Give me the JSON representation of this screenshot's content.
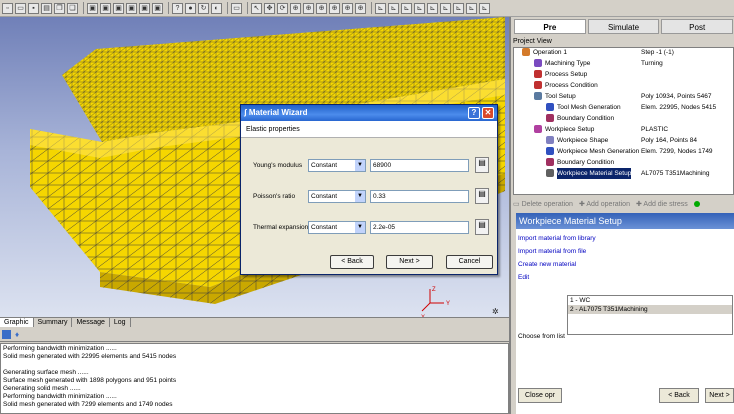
{
  "toolbar": {
    "icons": [
      "new-file-icon",
      "open-file-icon",
      "save-icon",
      "print-icon",
      "copy-icon",
      "paste-icon",
      "cube-icon",
      "cube-icon",
      "cube-icon",
      "cube-icon",
      "cube-icon",
      "cube-icon",
      "help-pointer-icon",
      "stop-icon",
      "refresh-icon",
      "color-icon",
      "rectangle-icon",
      "pointer-icon",
      "pan-icon",
      "rotate-icon",
      "zoom-icon",
      "zoom-icon",
      "zoom-icon",
      "zoom-icon",
      "zoom-icon",
      "zoom-icon",
      "axis-icon",
      "axis-icon",
      "axis-icon",
      "axis-icon",
      "axis-icon",
      "axis-icon",
      "axis-icon",
      "axis-icon",
      "axis-icon"
    ]
  },
  "viewport": {
    "tabs": [
      "Graphic",
      "Summary",
      "Message",
      "Log"
    ],
    "active_tab": "Graphic",
    "axis_labels": {
      "x": "X",
      "y": "Y",
      "z": "Z"
    },
    "mesh_color": "#f5d600"
  },
  "log": {
    "lines": [
      "Performing bandwidth minimization ......",
      "Solid mesh generated with 22995 elements and 5415 nodes",
      "",
      "Generating surface mesh ......",
      "Surface mesh generated with 1898 polygons and 951 points",
      "Generating solid mesh ......",
      "Performing bandwidth minimization ......",
      "Solid mesh generated with 7299 elements and 1749 nodes"
    ]
  },
  "right_panel": {
    "tabs": [
      "Pre",
      "Simulate",
      "Post"
    ],
    "active_tab": "Pre",
    "project_view_label": "Project View",
    "tree": [
      {
        "label": "Operation 1",
        "value": "Step -1 (-1)",
        "indent": 0,
        "icon": "operation-icon"
      },
      {
        "label": "Machining Type",
        "value": "Turning",
        "indent": 1,
        "icon": "machining-type-icon"
      },
      {
        "label": "Process Setup",
        "value": "",
        "indent": 1,
        "icon": "process-setup-icon"
      },
      {
        "label": "Process Condition",
        "value": "",
        "indent": 1,
        "icon": "process-condition-icon"
      },
      {
        "label": "Tool Setup",
        "value": "Poly 10934, Points 5467",
        "indent": 1,
        "icon": "tool-setup-icon"
      },
      {
        "label": "Tool Mesh Generation",
        "value": "Elem. 22995, Nodes 5415",
        "indent": 2,
        "icon": "mesh-icon"
      },
      {
        "label": "Boundary Condition",
        "value": "",
        "indent": 2,
        "icon": "boundary-icon"
      },
      {
        "label": "Workpiece Setup",
        "value": "PLASTIC",
        "indent": 1,
        "icon": "workpiece-setup-icon"
      },
      {
        "label": "Workpiece Shape",
        "value": "Poly 164, Points 84",
        "indent": 2,
        "icon": "shape-icon"
      },
      {
        "label": "Workpiece Mesh Generation",
        "value": "Elem. 7299, Nodes 1749",
        "indent": 2,
        "icon": "mesh-icon"
      },
      {
        "label": "Boundary Condition",
        "value": "",
        "indent": 2,
        "icon": "boundary-icon"
      },
      {
        "label": "Workpiece Material Setup",
        "value": "AL7075 T351Machining",
        "indent": 2,
        "icon": "material-icon",
        "selected": true
      }
    ],
    "operations": {
      "delete": "Delete operation",
      "add": "Add operation",
      "add_die": "Add die stress"
    },
    "section_title": "Workpiece Material Setup",
    "links": [
      "Import material from library",
      "Import material from file",
      "Create new material",
      "Edit"
    ],
    "choose_label": "Choose from list",
    "materials": [
      {
        "index": "1",
        "name": "- WC"
      },
      {
        "index": "2",
        "name": "- AL7075 T351Machining",
        "selected": true
      }
    ],
    "buttons": {
      "close": "Close opr",
      "back": "< Back",
      "next": "Next >"
    }
  },
  "dialog": {
    "title": "Material Wizard",
    "subtitle": "Elastic properties",
    "rows": [
      {
        "label": "Young's modulus",
        "mode": "Constant",
        "value": "68900"
      },
      {
        "label": "Poisson's ratio",
        "mode": "Constant",
        "value": "0.33"
      },
      {
        "label": "Thermal expansion",
        "mode": "Constant",
        "value": "2.2e-05"
      }
    ],
    "buttons": {
      "back": "< Back",
      "next": "Next >",
      "cancel": "Cancel"
    },
    "help": "?",
    "close": "✕"
  }
}
